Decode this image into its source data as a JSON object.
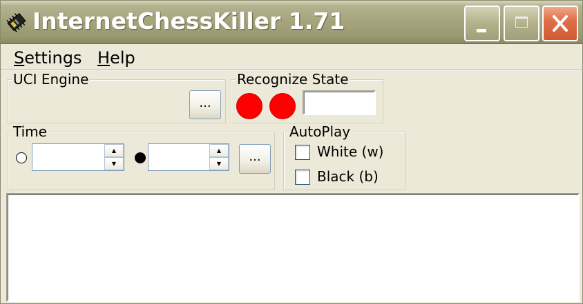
{
  "window": {
    "title": "InternetChessKiller 1.71",
    "buttons": {
      "minimize": "_",
      "maximize": "□",
      "close": "X"
    }
  },
  "menu": {
    "settings": {
      "mnemonic": "S",
      "rest": "ettings"
    },
    "help": {
      "mnemonic": "H",
      "rest": "elp"
    }
  },
  "uci_engine": {
    "label": "UCI Engine",
    "browse_label": "..."
  },
  "recognize_state": {
    "label": "Recognize State",
    "indicators": [
      "#ff0000",
      "#ff0000"
    ],
    "value": ""
  },
  "time": {
    "label": "Time",
    "white_value": "",
    "black_value": "",
    "settings_label": "...",
    "spin_up": "▲",
    "spin_down": "▼"
  },
  "autoplay": {
    "label": "AutoPlay",
    "white_label": "White (w)",
    "black_label": "Black (b)",
    "white_checked": false,
    "black_checked": false
  },
  "log": {
    "text": ""
  },
  "colors": {
    "face": "#ECE9D8",
    "indicator_red": "#ff0000",
    "close_button": "#e0704a"
  },
  "icons": {
    "app": "chip-icon",
    "white_radio": "white-radio-icon",
    "black_radio": "black-radio-icon"
  }
}
